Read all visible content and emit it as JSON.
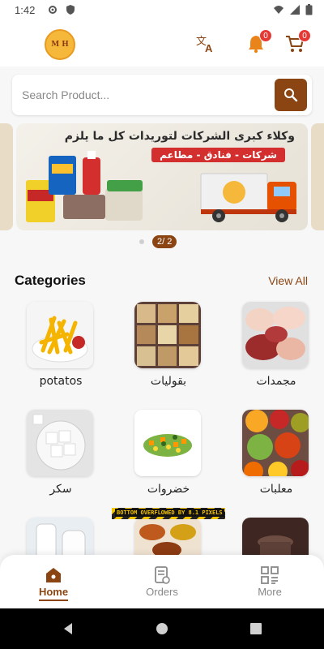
{
  "status_bar": {
    "time": "1:42"
  },
  "header": {
    "logo_text": "M H",
    "notification_count": "0",
    "cart_count": "0"
  },
  "search": {
    "placeholder": "Search Product..."
  },
  "banner": {
    "title": "وكلاء كبرى الشركات لتوريدات كل ما يلزم",
    "subtitle": "شركات - فنادق - مطاعم",
    "page_indicator": "2/ 2"
  },
  "categories": {
    "title": "Categories",
    "view_all": "View All",
    "items": [
      {
        "label": "potatos"
      },
      {
        "label": "بقوليات"
      },
      {
        "label": "مجمدات"
      },
      {
        "label": "سكر"
      },
      {
        "label": "خضروات"
      },
      {
        "label": "معلبات"
      }
    ]
  },
  "overflow_warning": "BOTTOM OVERFLOWED BY 8.1 PIXELS",
  "bottom_nav": {
    "home": "Home",
    "orders": "Orders",
    "more": "More"
  },
  "colors": {
    "accent": "#8b4513",
    "badge": "#e53935"
  }
}
